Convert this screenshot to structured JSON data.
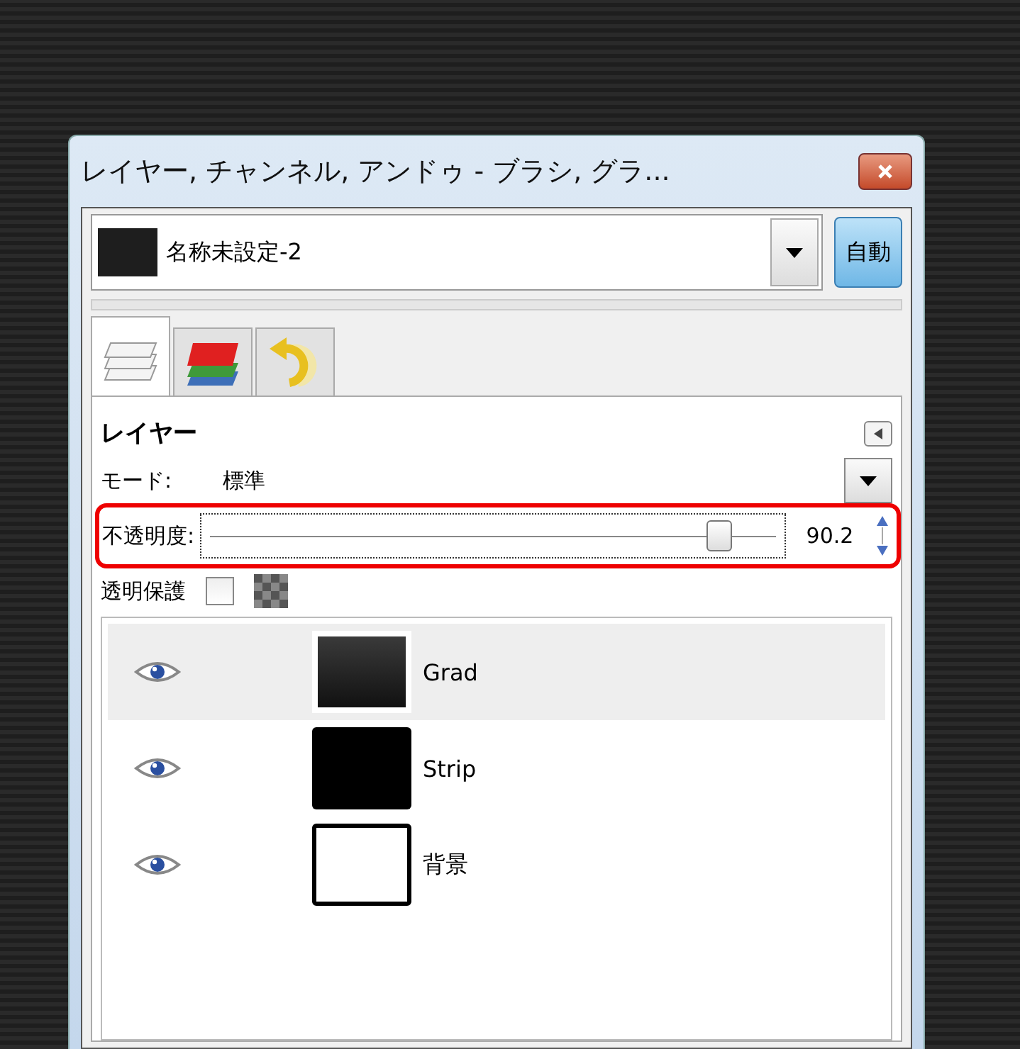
{
  "window": {
    "title": "レイヤー, チャンネル, アンドゥ - ブラシ, グラ..."
  },
  "image_selector": {
    "name": "名称未設定-2",
    "button": "自動"
  },
  "tabs": [
    {
      "kind": "layers",
      "selected": true
    },
    {
      "kind": "channels",
      "selected": false
    },
    {
      "kind": "undo",
      "selected": false
    }
  ],
  "panel": {
    "title": "レイヤー",
    "mode_label": "モード:",
    "mode_value": "標準",
    "opacity_label": "不透明度:",
    "opacity": {
      "level": 0.9,
      "reading": "90.2"
    },
    "lock_label": "透明保護",
    "lock_checked": false
  },
  "layers": [
    {
      "name": "Grad",
      "kind": "gradient",
      "selected": true
    },
    {
      "name": "Strip",
      "kind": "black",
      "selected": false
    },
    {
      "name": "背景",
      "kind": "white",
      "selected": false
    }
  ]
}
